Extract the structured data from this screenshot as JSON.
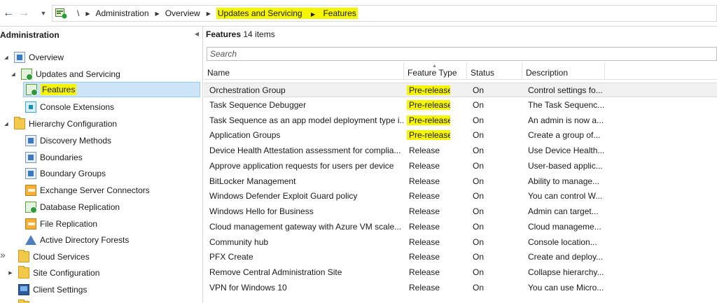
{
  "breadcrumb": {
    "root": "\\",
    "items": [
      "Administration",
      "Overview",
      "Updates and Servicing",
      "Features"
    ],
    "highlight_color": "#f5f500"
  },
  "left_pane": {
    "title": "Administration",
    "tree": [
      {
        "label": "Overview",
        "icon": "overview-icon",
        "expanded": true
      },
      {
        "label": "Updates and Servicing",
        "icon": "updates-icon",
        "expanded": true
      },
      {
        "label": "Features",
        "icon": "features-icon",
        "selected": true
      },
      {
        "label": "Console Extensions",
        "icon": "console-extensions-icon"
      },
      {
        "label": "Hierarchy Configuration",
        "icon": "folder-icon",
        "expanded": true
      },
      {
        "label": "Discovery Methods",
        "icon": "discovery-icon"
      },
      {
        "label": "Boundaries",
        "icon": "boundaries-icon"
      },
      {
        "label": "Boundary Groups",
        "icon": "boundary-groups-icon"
      },
      {
        "label": "Exchange Server Connectors",
        "icon": "exchange-icon"
      },
      {
        "label": "Database Replication",
        "icon": "database-replication-icon"
      },
      {
        "label": "File Replication",
        "icon": "file-replication-icon"
      },
      {
        "label": "Active Directory Forests",
        "icon": "ad-forests-icon"
      },
      {
        "label": "Cloud Services",
        "icon": "folder-icon"
      },
      {
        "label": "Site Configuration",
        "icon": "folder-icon"
      },
      {
        "label": "Client Settings",
        "icon": "client-settings-icon"
      }
    ]
  },
  "right_pane": {
    "title": "Features",
    "count": "14 items",
    "search_placeholder": "Search",
    "columns": [
      "Name",
      "Feature Type",
      "Status",
      "Description"
    ],
    "rows": [
      {
        "name": "Orchestration Group",
        "type": "Pre-release",
        "status": "On",
        "desc": "Control settings fo...",
        "highlight": true
      },
      {
        "name": "Task Sequence Debugger",
        "type": "Pre-release",
        "status": "On",
        "desc": "The Task Sequenc...",
        "highlight": true
      },
      {
        "name": "Task Sequence as an app model deployment type i...",
        "type": "Pre-release",
        "status": "On",
        "desc": "An admin is now a...",
        "highlight": true
      },
      {
        "name": "Application Groups",
        "type": "Pre-release",
        "status": "On",
        "desc": "Create a group of...",
        "highlight": true
      },
      {
        "name": "Device Health Attestation assessment for complia...",
        "type": "Release",
        "status": "On",
        "desc": "Use Device Health..."
      },
      {
        "name": "Approve application requests for users per device",
        "type": "Release",
        "status": "On",
        "desc": "User-based applic..."
      },
      {
        "name": "BitLocker Management",
        "type": "Release",
        "status": "On",
        "desc": "Ability to manage..."
      },
      {
        "name": "Windows Defender Exploit Guard policy",
        "type": "Release",
        "status": "On",
        "desc": "You can control W..."
      },
      {
        "name": "Windows Hello for Business",
        "type": "Release",
        "status": "On",
        "desc": "Admin can target..."
      },
      {
        "name": "Cloud management gateway with Azure VM scale...",
        "type": "Release",
        "status": "On",
        "desc": "Cloud manageme..."
      },
      {
        "name": "Community hub",
        "type": "Release",
        "status": "On",
        "desc": "Console location..."
      },
      {
        "name": "PFX Create",
        "type": "Release",
        "status": "On",
        "desc": "Create and deploy..."
      },
      {
        "name": "Remove Central Administration Site",
        "type": "Release",
        "status": "On",
        "desc": "Collapse hierarchy..."
      },
      {
        "name": "VPN for Windows 10",
        "type": "Release",
        "status": "On",
        "desc": "You can use Micro..."
      }
    ]
  }
}
